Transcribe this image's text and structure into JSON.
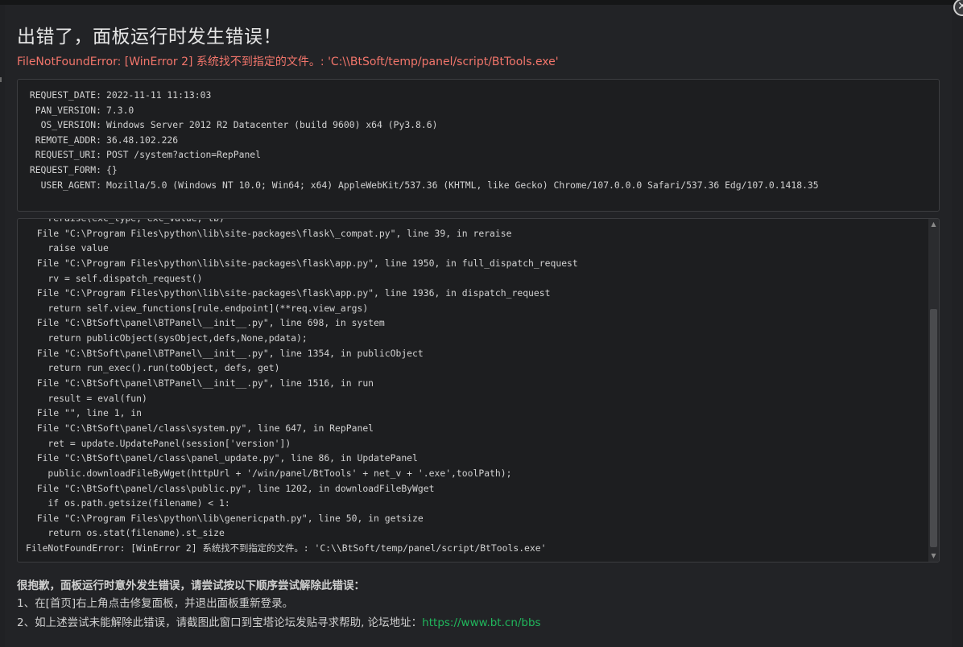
{
  "dialog": {
    "title": "出错了，面板运行时发生错误！",
    "error_message": "FileNotFoundError: [WinError 2] 系统找不到指定的文件。: 'C:\\\\BtSoft/temp/panel/script/BtTools.exe'",
    "close_icon": "close-icon"
  },
  "request_info": [
    {
      "key": "REQUEST_DATE:",
      "value": "2022-11-11 11:13:03"
    },
    {
      "key": "PAN_VERSION:",
      "value": "7.3.0"
    },
    {
      "key": "OS_VERSION:",
      "value": "Windows Server 2012 R2 Datacenter (build 9600) x64 (Py3.8.6)"
    },
    {
      "key": "REMOTE_ADDR:",
      "value": "36.48.102.226"
    },
    {
      "key": "REQUEST_URI:",
      "value": "POST /system?action=RepPanel"
    },
    {
      "key": "REQUEST_FORM:",
      "value": "{}"
    },
    {
      "key": "USER_AGENT:",
      "value": "Mozilla/5.0 (Windows NT 10.0; Win64; x64) AppleWebKit/537.36 (KHTML, like Gecko) Chrome/107.0.0.0 Safari/537.36 Edg/107.0.1418.35"
    }
  ],
  "traceback": [
    "    reraise(exc_type, exc_value, tb)",
    "  File \"C:\\Program Files\\python\\lib\\site-packages\\flask\\_compat.py\", line 39, in reraise",
    "    raise value",
    "  File \"C:\\Program Files\\python\\lib\\site-packages\\flask\\app.py\", line 1950, in full_dispatch_request",
    "    rv = self.dispatch_request()",
    "  File \"C:\\Program Files\\python\\lib\\site-packages\\flask\\app.py\", line 1936, in dispatch_request",
    "    return self.view_functions[rule.endpoint](**req.view_args)",
    "  File \"C:\\BtSoft\\panel\\BTPanel\\__init__.py\", line 698, in system",
    "    return publicObject(sysObject,defs,None,pdata);",
    "  File \"C:\\BtSoft\\panel\\BTPanel\\__init__.py\", line 1354, in publicObject",
    "    return run_exec().run(toObject, defs, get)",
    "  File \"C:\\BtSoft\\panel\\BTPanel\\__init__.py\", line 1516, in run",
    "    result = eval(fun)",
    "  File \"\", line 1, in",
    "  File \"C:\\BtSoft\\panel/class\\system.py\", line 647, in RepPanel",
    "    ret = update.UpdatePanel(session['version'])",
    "  File \"C:\\BtSoft\\panel/class\\panel_update.py\", line 86, in UpdatePanel",
    "    public.downloadFileByWget(httpUrl + '/win/panel/BtTools' + net_v + '.exe',toolPath);",
    "  File \"C:\\BtSoft\\panel/class\\public.py\", line 1202, in downloadFileByWget",
    "    if os.path.getsize(filename) < 1:",
    "  File \"C:\\Program Files\\python\\lib\\genericpath.py\", line 50, in getsize",
    "    return os.stat(filename).st_size",
    "FileNotFoundError: [WinError 2] 系统找不到指定的文件。: 'C:\\\\BtSoft/temp/panel/script/BtTools.exe'"
  ],
  "help": {
    "title": "很抱歉，面板运行时意外发生错误，请尝试按以下顺序尝试解除此错误：",
    "step1": "1、在[首页]右上角点击修复面板，并退出面板重新登录。",
    "step2_prefix": "2、如上述尝试未能解除此错误，请截图此窗口到宝塔论坛发贴寻求帮助, 论坛地址：",
    "forum_link": "https://www.bt.cn/bbs"
  }
}
